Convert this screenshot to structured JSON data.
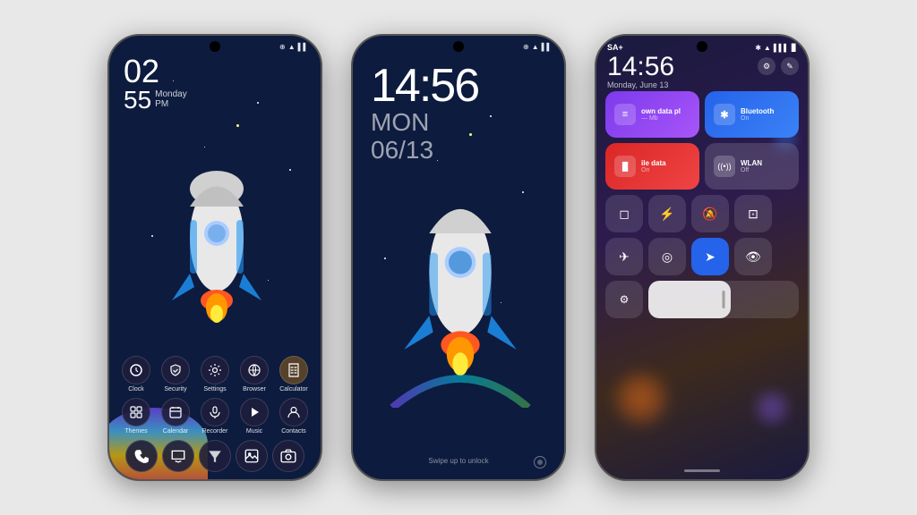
{
  "phone1": {
    "status_icons": "⊕ ⊙ ▲ ▌▌",
    "clock": {
      "hour": "02",
      "minutes": "55",
      "day": "Monday",
      "period": "PM"
    },
    "apps_row1": [
      {
        "label": "Clock",
        "icon": "🕐"
      },
      {
        "label": "Security",
        "icon": "🛡"
      },
      {
        "label": "Settings",
        "icon": "⚙"
      },
      {
        "label": "Browser",
        "icon": "🌐"
      },
      {
        "label": "Calculator",
        "icon": "⚠"
      }
    ],
    "apps_row2": [
      {
        "label": "Themes",
        "icon": "⊞"
      },
      {
        "label": "Calendar",
        "icon": "📅"
      },
      {
        "label": "Recorder",
        "icon": "🎙"
      },
      {
        "label": "Music",
        "icon": "▶"
      },
      {
        "label": "Contacts",
        "icon": "👤"
      }
    ],
    "dock": [
      {
        "label": "Phone",
        "icon": "📞"
      },
      {
        "label": "Messages",
        "icon": "💬"
      },
      {
        "label": "Assistant",
        "icon": "🔽"
      },
      {
        "label": "Gallery",
        "icon": "🖼"
      },
      {
        "label": "Camera",
        "icon": "📷"
      }
    ]
  },
  "phone2": {
    "status_icons": "⊕ ⊙ ▲ ▌▌",
    "time": "14:56",
    "day_line1": "MON",
    "day_line2": "06/13",
    "swipe_hint": "Swipe up to unlock"
  },
  "phone3": {
    "carrier": "SA+",
    "status_icons": "✱ ▲ ▌▌▌ ▊",
    "time": "14:56",
    "date": "Monday, June 13",
    "tiles_row1": [
      {
        "label": "own data pl",
        "sub": "— Mb",
        "color": "purple",
        "icon": "≡"
      },
      {
        "label": "Bluetooth",
        "sub": "On",
        "color": "blue",
        "icon": "✱"
      }
    ],
    "tiles_row2": [
      {
        "label": "ile data",
        "sub": "On",
        "color": "red",
        "icon": "▐▌"
      },
      {
        "label": "WLAN",
        "sub": "Off",
        "color": "gray",
        "icon": "((•))"
      }
    ],
    "small_tiles": [
      {
        "icon": "◻",
        "active": false
      },
      {
        "icon": "⚡",
        "active": false
      },
      {
        "icon": "🔕",
        "active": false
      },
      {
        "icon": "⊡",
        "active": false
      }
    ],
    "bottom_tiles": [
      {
        "icon": "✈",
        "active": false
      },
      {
        "icon": "◎",
        "active": false
      },
      {
        "icon": "➤",
        "active": true
      },
      {
        "icon": "👁",
        "active": false
      }
    ],
    "brightness": 55
  }
}
